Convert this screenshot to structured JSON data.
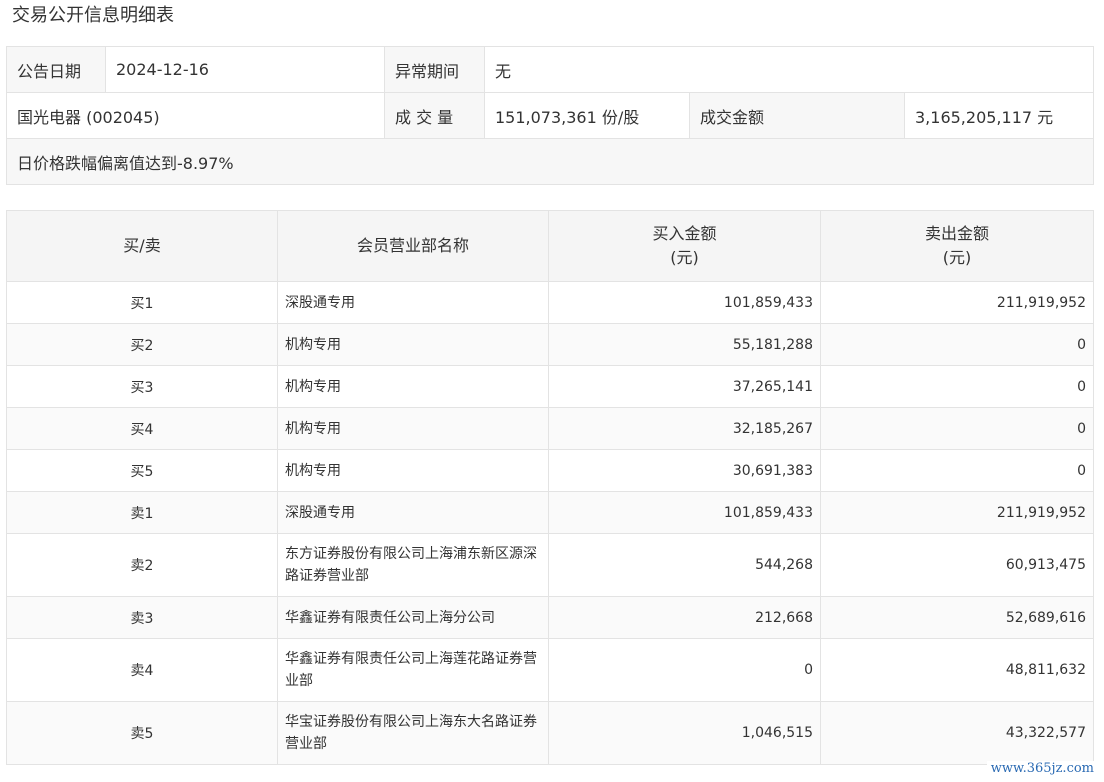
{
  "page_title": "交易公开信息明细表",
  "info": {
    "date_label": "公告日期",
    "date_value": "2024-12-16",
    "abnormal_label": "异常期间",
    "abnormal_value": "无",
    "stock_name": "国光电器 (002045)",
    "volume_label": "成 交 量",
    "volume_value": "151,073,361 份/股",
    "amount_label": "成交金额",
    "amount_value": "3,165,205,117 元",
    "reason": "日价格跌幅偏离值达到-8.97%"
  },
  "detail": {
    "headers": {
      "direction": "买/卖",
      "branch": "会员营业部名称",
      "buy_line1": "买入金额",
      "buy_line2": "(元)",
      "sell_line1": "卖出金额",
      "sell_line2": "(元)"
    },
    "rows": [
      {
        "direction": "买1",
        "branch": "深股通专用",
        "buy": "101,859,433",
        "sell": "211,919,952"
      },
      {
        "direction": "买2",
        "branch": "机构专用",
        "buy": "55,181,288",
        "sell": "0"
      },
      {
        "direction": "买3",
        "branch": "机构专用",
        "buy": "37,265,141",
        "sell": "0"
      },
      {
        "direction": "买4",
        "branch": "机构专用",
        "buy": "32,185,267",
        "sell": "0"
      },
      {
        "direction": "买5",
        "branch": "机构专用",
        "buy": "30,691,383",
        "sell": "0"
      },
      {
        "direction": "卖1",
        "branch": "深股通专用",
        "buy": "101,859,433",
        "sell": "211,919,952"
      },
      {
        "direction": "卖2",
        "branch": "东方证券股份有限公司上海浦东新区源深路证券营业部",
        "buy": "544,268",
        "sell": "60,913,475"
      },
      {
        "direction": "卖3",
        "branch": "华鑫证券有限责任公司上海分公司",
        "buy": "212,668",
        "sell": "52,689,616"
      },
      {
        "direction": "卖4",
        "branch": "华鑫证券有限责任公司上海莲花路证券营业部",
        "buy": "0",
        "sell": "48,811,632"
      },
      {
        "direction": "卖5",
        "branch": "华宝证券股份有限公司上海东大名路证券营业部",
        "buy": "1,046,515",
        "sell": "43,322,577"
      }
    ]
  },
  "watermark": "www.365jz.com"
}
